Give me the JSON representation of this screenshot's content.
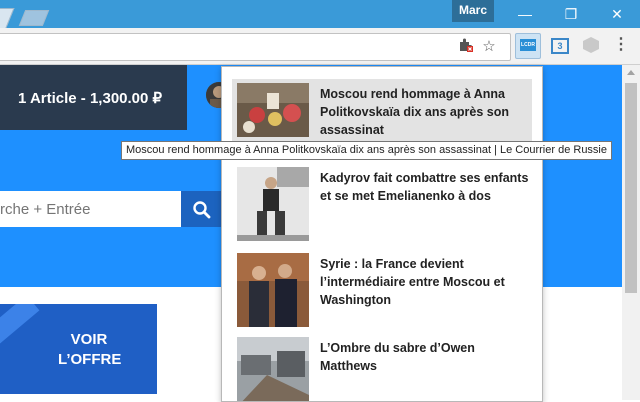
{
  "browser": {
    "profile_name": "Marc",
    "controls": {
      "minimize": "—",
      "maximize": "❐",
      "close": "✕"
    },
    "toolbar": {
      "ext_icon": "puzzle-icon",
      "star_icon": "star-icon",
      "extensions": [
        "lcm-extension-icon",
        "panel-extension-icon",
        "box-extension-icon"
      ],
      "menu_icon": "⋮",
      "lcm_label": "LCDR",
      "panel_label": "3"
    }
  },
  "site": {
    "cart_text": "1 Article - 1,300.00 ₽",
    "search_placeholder": "rche + Entrée",
    "offer_text": "VOIR L’OFFRE"
  },
  "popup": {
    "articles": [
      {
        "title": "Moscou rend hommage à Anna Politkovskaïa dix ans après son assassinat"
      },
      {
        "title": "Kadyrov fait combattre ses enfants et se met Emelianenko à dos"
      },
      {
        "title": "Syrie : la France devient l’intermédiaire entre Moscou et Washington"
      },
      {
        "title": "L’Ombre du sabre d’Owen Matthews"
      }
    ]
  },
  "tooltip": {
    "text": "Moscou rend hommage à Anna Politkovskaïa dix ans après son assassinat | Le Courrier de Russie"
  },
  "colors": {
    "title_bar": "#3a9ad8",
    "hero_blue": "#1e90ff",
    "search_button": "#1c63bf",
    "cart_bg": "#2a3a4e",
    "offer_bg": "#1f5fc5"
  }
}
